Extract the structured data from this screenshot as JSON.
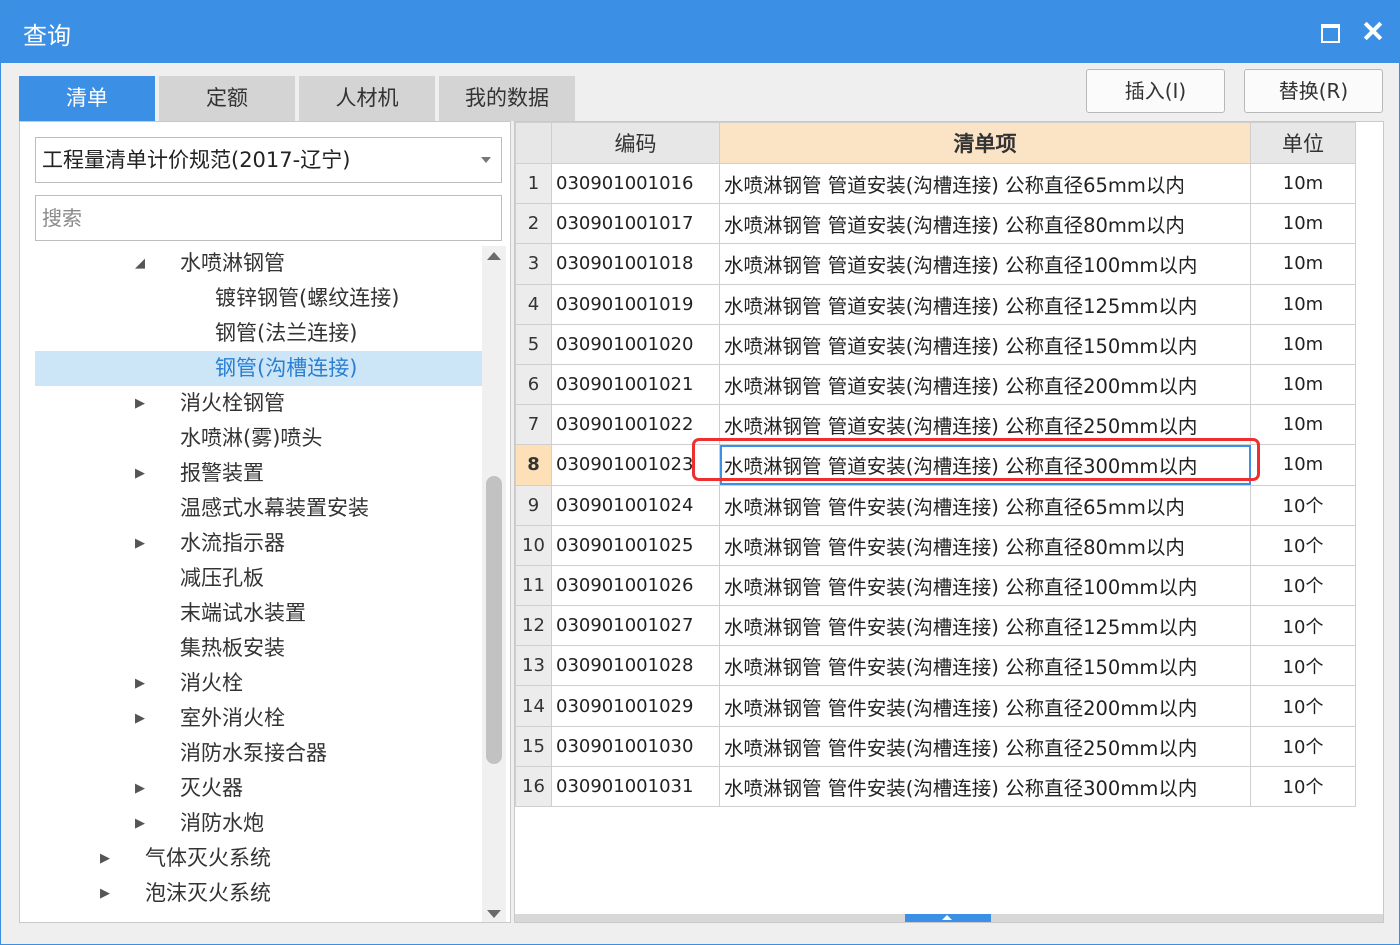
{
  "window": {
    "title": "查询"
  },
  "tabs": [
    {
      "label": "清单",
      "active": true
    },
    {
      "label": "定额",
      "active": false
    },
    {
      "label": "人材机",
      "active": false
    },
    {
      "label": "我的数据",
      "active": false
    }
  ],
  "actions": {
    "insert": "插入(I)",
    "replace": "替换(R)"
  },
  "left": {
    "norm_select": "工程量清单计价规范(2017-辽宁)",
    "search_placeholder": "搜索",
    "tree": [
      {
        "label": "水喷淋钢管",
        "expander": "expanded"
      },
      {
        "label": "镀锌钢管(螺纹连接)",
        "expander": "none"
      },
      {
        "label": "钢管(法兰连接)",
        "expander": "none"
      },
      {
        "label": "钢管(沟槽连接)",
        "expander": "none",
        "selected": true
      },
      {
        "label": "消火栓钢管",
        "expander": "collapsed"
      },
      {
        "label": "水喷淋(雾)喷头",
        "expander": "none"
      },
      {
        "label": "报警装置",
        "expander": "collapsed"
      },
      {
        "label": "温感式水幕装置安装",
        "expander": "none"
      },
      {
        "label": "水流指示器",
        "expander": "collapsed"
      },
      {
        "label": "减压孔板",
        "expander": "none"
      },
      {
        "label": "末端试水装置",
        "expander": "none"
      },
      {
        "label": "集热板安装",
        "expander": "none"
      },
      {
        "label": "消火栓",
        "expander": "collapsed"
      },
      {
        "label": "室外消火栓",
        "expander": "collapsed"
      },
      {
        "label": "消防水泵接合器",
        "expander": "none"
      },
      {
        "label": "灭火器",
        "expander": "collapsed"
      },
      {
        "label": "消防水炮",
        "expander": "collapsed"
      },
      {
        "label": "气体灭火系统",
        "expander": "collapsed"
      },
      {
        "label": "泡沫灭火系统",
        "expander": "collapsed"
      }
    ]
  },
  "grid": {
    "columns": {
      "code": "编码",
      "item": "清单项",
      "unit": "单位"
    },
    "current_row": 8,
    "rows": [
      {
        "no": "1",
        "code": "030901001016",
        "item": "水喷淋钢管 管道安装(沟槽连接) 公称直径65mm以内",
        "unit": "10m"
      },
      {
        "no": "2",
        "code": "030901001017",
        "item": "水喷淋钢管 管道安装(沟槽连接) 公称直径80mm以内",
        "unit": "10m"
      },
      {
        "no": "3",
        "code": "030901001018",
        "item": "水喷淋钢管 管道安装(沟槽连接) 公称直径100mm以内",
        "unit": "10m"
      },
      {
        "no": "4",
        "code": "030901001019",
        "item": "水喷淋钢管 管道安装(沟槽连接) 公称直径125mm以内",
        "unit": "10m"
      },
      {
        "no": "5",
        "code": "030901001020",
        "item": "水喷淋钢管 管道安装(沟槽连接) 公称直径150mm以内",
        "unit": "10m"
      },
      {
        "no": "6",
        "code": "030901001021",
        "item": "水喷淋钢管 管道安装(沟槽连接) 公称直径200mm以内",
        "unit": "10m"
      },
      {
        "no": "7",
        "code": "030901001022",
        "item": "水喷淋钢管 管道安装(沟槽连接) 公称直径250mm以内",
        "unit": "10m"
      },
      {
        "no": "8",
        "code": "030901001023",
        "item": "水喷淋钢管 管道安装(沟槽连接) 公称直径300mm以内",
        "unit": "10m"
      },
      {
        "no": "9",
        "code": "030901001024",
        "item": "水喷淋钢管 管件安装(沟槽连接) 公称直径65mm以内",
        "unit": "10个"
      },
      {
        "no": "10",
        "code": "030901001025",
        "item": "水喷淋钢管 管件安装(沟槽连接) 公称直径80mm以内",
        "unit": "10个"
      },
      {
        "no": "11",
        "code": "030901001026",
        "item": "水喷淋钢管 管件安装(沟槽连接) 公称直径100mm以内",
        "unit": "10个"
      },
      {
        "no": "12",
        "code": "030901001027",
        "item": "水喷淋钢管 管件安装(沟槽连接) 公称直径125mm以内",
        "unit": "10个"
      },
      {
        "no": "13",
        "code": "030901001028",
        "item": "水喷淋钢管 管件安装(沟槽连接) 公称直径150mm以内",
        "unit": "10个"
      },
      {
        "no": "14",
        "code": "030901001029",
        "item": "水喷淋钢管 管件安装(沟槽连接) 公称直径200mm以内",
        "unit": "10个"
      },
      {
        "no": "15",
        "code": "030901001030",
        "item": "水喷淋钢管 管件安装(沟槽连接) 公称直径250mm以内",
        "unit": "10个"
      },
      {
        "no": "16",
        "code": "030901001031",
        "item": "水喷淋钢管 管件安装(沟槽连接) 公称直径300mm以内",
        "unit": "10个"
      }
    ]
  },
  "colors": {
    "accent": "#3b8fe5",
    "highlight_box": "#ee2f2f",
    "selected_tree": "#cde6f7",
    "header_highlight": "#fbe3c5"
  }
}
